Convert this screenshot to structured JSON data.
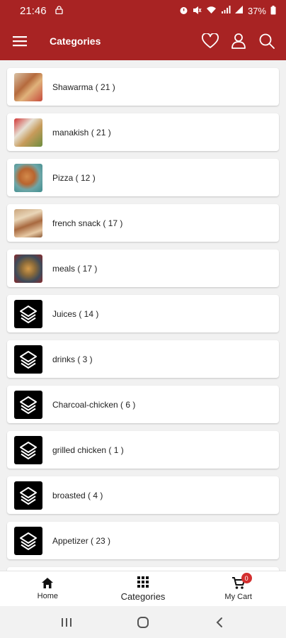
{
  "status_bar": {
    "time": "21:46",
    "battery": "37%"
  },
  "app_bar": {
    "title": "Categories",
    "menu_icon": "menu-icon",
    "favorites_icon": "heart-icon",
    "account_icon": "user-icon",
    "search_icon": "search-icon"
  },
  "categories": [
    {
      "label": "Shawarma ( 21 )",
      "thumb": "f1"
    },
    {
      "label": "manakish ( 21 )",
      "thumb": "f2"
    },
    {
      "label": "Pizza ( 12 )",
      "thumb": "f3"
    },
    {
      "label": "french snack ( 17 )",
      "thumb": "f4"
    },
    {
      "label": "meals ( 17 )",
      "thumb": "f5"
    },
    {
      "label": "Juices ( 14 )",
      "thumb": "logo"
    },
    {
      "label": "drinks ( 3 )",
      "thumb": "logo"
    },
    {
      "label": "Charcoal-chicken ( 6 )",
      "thumb": "logo"
    },
    {
      "label": "grilled chicken ( 1 )",
      "thumb": "logo"
    },
    {
      "label": "broasted ( 4 )",
      "thumb": "logo"
    },
    {
      "label": "Appetizer ( 23 )",
      "thumb": "logo"
    }
  ],
  "bottom_nav": {
    "home": "Home",
    "categories": "Categories",
    "cart": "My Cart",
    "cart_count": "0"
  },
  "colors": {
    "brand": "#a82323",
    "badge": "#d32f2f"
  }
}
